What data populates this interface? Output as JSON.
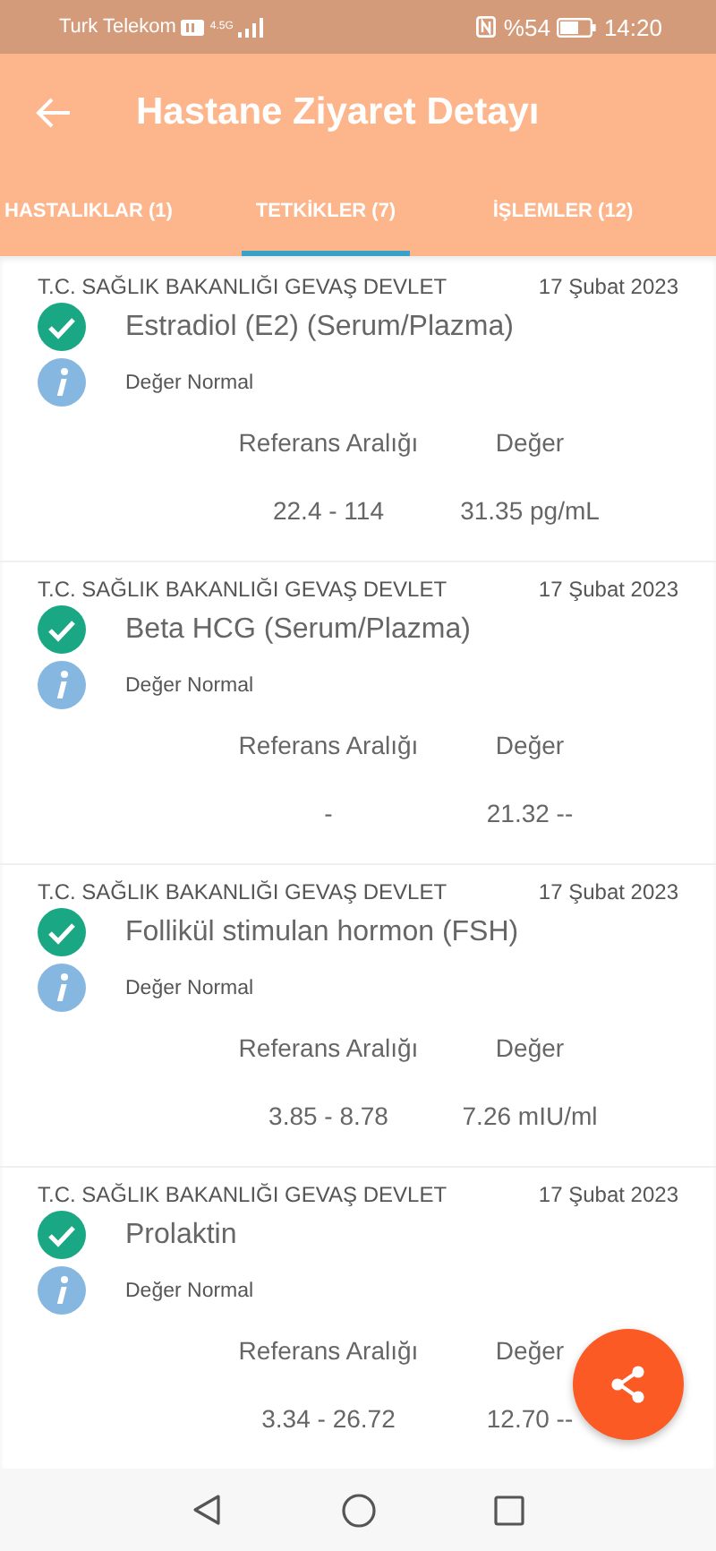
{
  "status_bar": {
    "carrier": "Turk Telekom",
    "network": "4.5G",
    "battery": "%54",
    "time": "14:20"
  },
  "app_bar": {
    "title": "Hastane Ziyaret Detayı"
  },
  "tabs": [
    {
      "label": "HASTALIKLAR (1)",
      "selected": false
    },
    {
      "label": "TETKİKLER (7)",
      "selected": true
    },
    {
      "label": "İŞLEMLER (12)",
      "selected": false
    }
  ],
  "tests": [
    {
      "hospital": "T.C. SAĞLIK BAKANLIĞI GEVAŞ DEVLET",
      "date": "17 Şubat 2023",
      "name": "Estradiol (E2) (Serum/Plazma)",
      "status": "Değer Normal",
      "range_label": "Referans Aralığı",
      "value_label": "Değer",
      "range": "22.4 - 114",
      "value": "31.35 pg/mL"
    },
    {
      "hospital": "T.C. SAĞLIK BAKANLIĞI GEVAŞ DEVLET",
      "date": "17 Şubat 2023",
      "name": "Beta HCG (Serum/Plazma)",
      "status": "Değer Normal",
      "range_label": "Referans Aralığı",
      "value_label": "Değer",
      "range": "-",
      "value": "21.32 --"
    },
    {
      "hospital": "T.C. SAĞLIK BAKANLIĞI GEVAŞ DEVLET",
      "date": "17 Şubat 2023",
      "name": "Follikül stimulan hormon (FSH)",
      "status": "Değer Normal",
      "range_label": "Referans Aralığı",
      "value_label": "Değer",
      "range": "3.85 - 8.78",
      "value": "7.26 mIU/ml"
    },
    {
      "hospital": "T.C. SAĞLIK BAKANLIĞI GEVAŞ DEVLET",
      "date": "17 Şubat 2023",
      "name": "Prolaktin",
      "status": "Değer Normal",
      "range_label": "Referans Aralığı",
      "value_label": "Değer",
      "range": "3.34 - 26.72",
      "value": "12.70 --"
    }
  ]
}
